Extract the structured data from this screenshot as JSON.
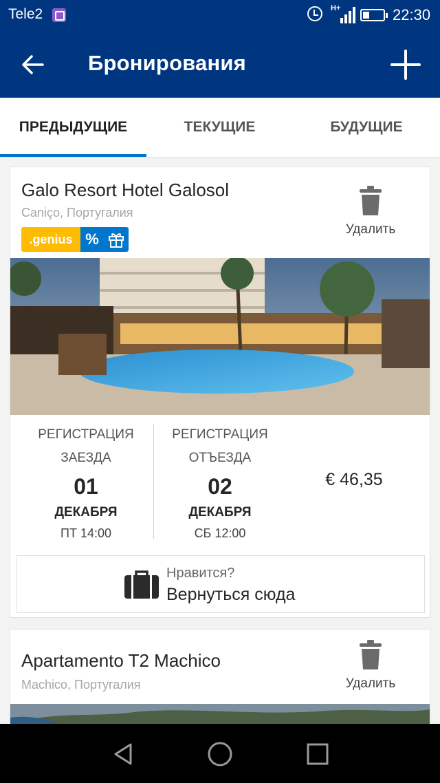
{
  "status_bar": {
    "carrier": "Tele2",
    "time": "22:30",
    "network": "H+"
  },
  "app_bar": {
    "title": "Бронирования"
  },
  "tabs": [
    {
      "label": "ПРЕДЫДУЩИЕ",
      "active": true
    },
    {
      "label": "ТЕКУЩИЕ",
      "active": false
    },
    {
      "label": "БУДУЩИЕ",
      "active": false
    }
  ],
  "bookings": [
    {
      "name": "Galo Resort Hotel Galosol",
      "location": "Caniço, Португалия",
      "delete_label": "Удалить",
      "badges": {
        "genius": ".genius",
        "discount": "%"
      },
      "checkin": {
        "label_line1": "РЕГИСТРАЦИЯ",
        "label_line2": "ЗАЕЗДА",
        "day": "01",
        "month": "ДЕКАБРЯ",
        "time": "ПТ 14:00"
      },
      "checkout": {
        "label_line1": "РЕГИСТРАЦИЯ",
        "label_line2": "ОТЪЕЗДА",
        "day": "02",
        "month": "ДЕКАБРЯ",
        "time": "СБ 12:00"
      },
      "price": "€ 46,35",
      "rebook": {
        "question": "Нравится?",
        "action": "Вернуться сюда"
      }
    },
    {
      "name": "Apartamento T2 Machico",
      "location": "Machico, Португалия",
      "delete_label": "Удалить"
    }
  ],
  "colors": {
    "brand": "#003580",
    "accent": "#0077cc",
    "genius": "#febb02"
  }
}
